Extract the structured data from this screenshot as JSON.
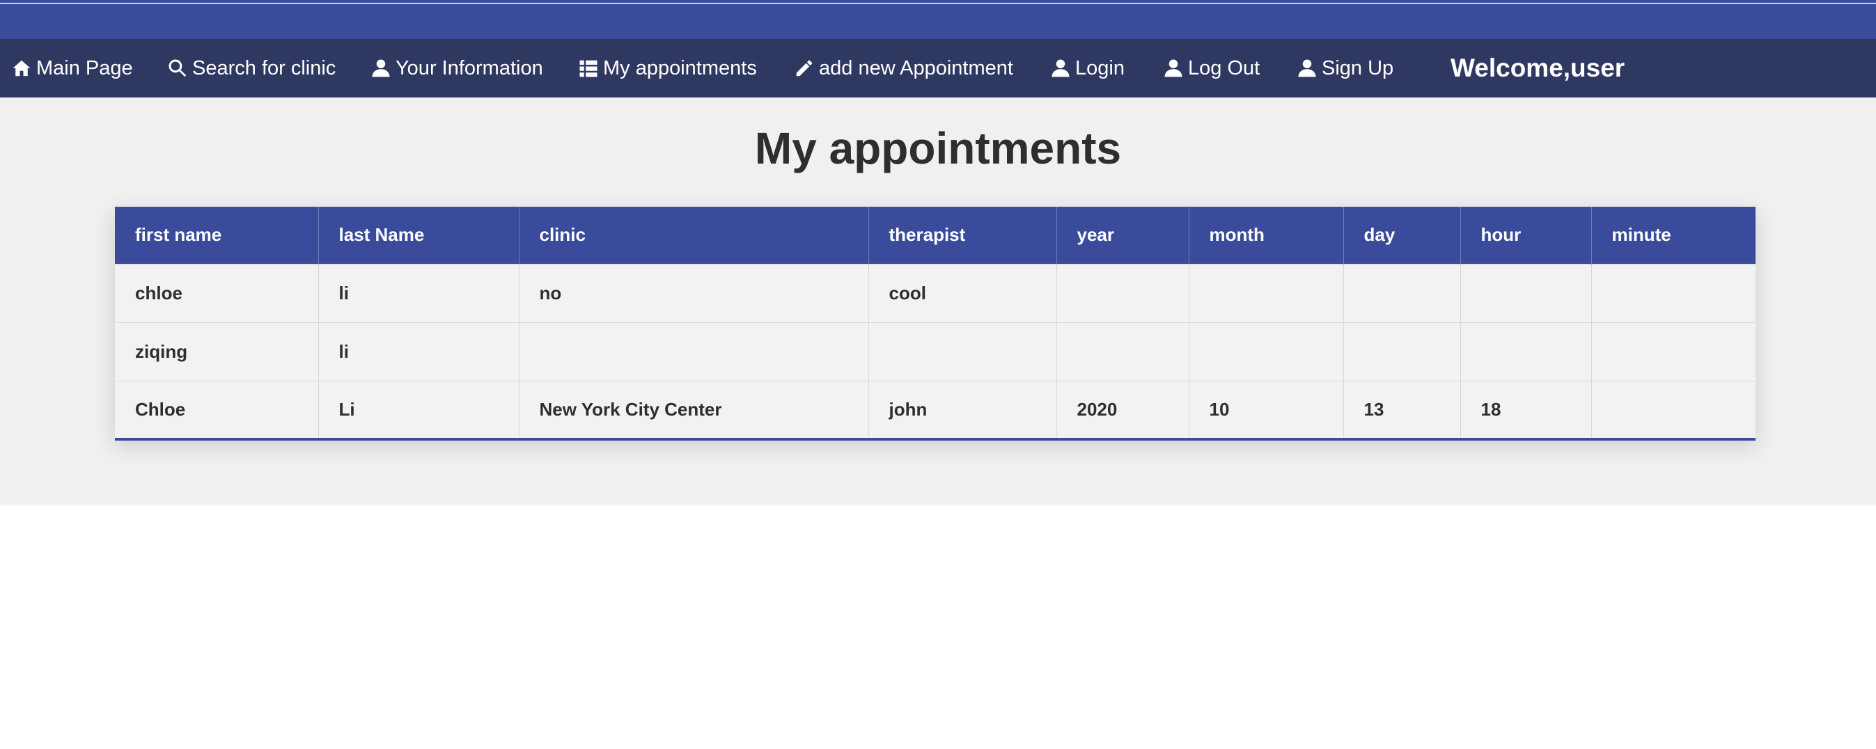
{
  "nav": {
    "items": [
      {
        "label": "Main Page",
        "icon": "home-icon"
      },
      {
        "label": "Search for clinic",
        "icon": "search-icon"
      },
      {
        "label": "Your Information",
        "icon": "user-icon"
      },
      {
        "label": "My appointments",
        "icon": "list-icon"
      },
      {
        "label": "add new Appointment",
        "icon": "pencil-icon"
      },
      {
        "label": "Login",
        "icon": "user-icon"
      },
      {
        "label": "Log Out",
        "icon": "user-icon"
      },
      {
        "label": "Sign Up",
        "icon": "user-icon"
      }
    ],
    "welcome": "Welcome,user"
  },
  "page": {
    "title": "My appointments"
  },
  "table": {
    "headers": [
      "first name",
      "last Name",
      "clinic",
      "therapist",
      "year",
      "month",
      "day",
      "hour",
      "minute"
    ],
    "rows": [
      [
        "chloe",
        "li",
        "no",
        "cool",
        "",
        "",
        "",
        "",
        ""
      ],
      [
        "ziqing",
        "li",
        "",
        "",
        "",
        "",
        "",
        "",
        ""
      ],
      [
        "Chloe",
        "Li",
        "New York City Center",
        "john",
        "2020",
        "10",
        "13",
        "18",
        ""
      ]
    ]
  },
  "colors": {
    "primary": "#3a4b9c",
    "navbar": "#2f3860",
    "content_bg": "#f0f0f0"
  }
}
